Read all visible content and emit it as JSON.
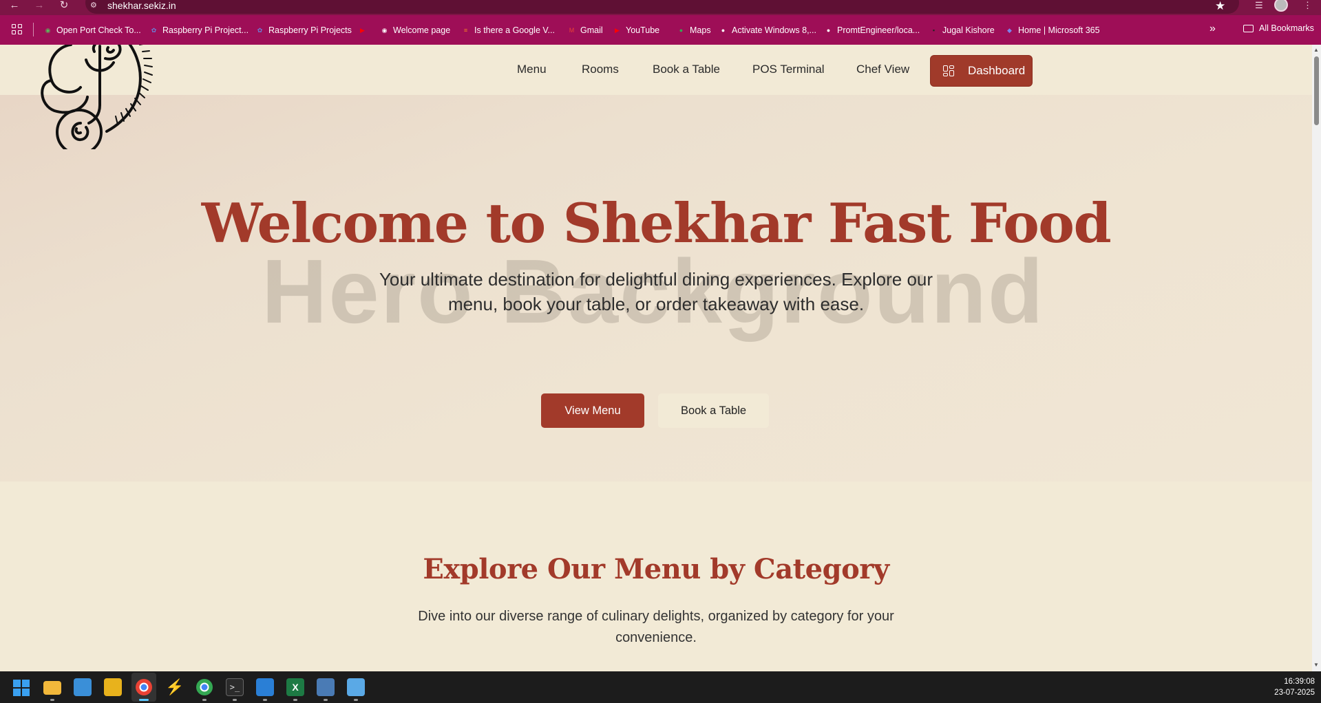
{
  "browser": {
    "url": "shekhar.sekiz.in",
    "back_icon": "arrow-left-icon",
    "forward_icon": "arrow-right-icon",
    "reload_icon": "reload-icon",
    "bookmarks": [
      {
        "label": "Open Port Check To...",
        "icon": "globe-icon",
        "color": "#5cb85c"
      },
      {
        "label": "Raspberry Pi Project...",
        "icon": "pi-icon",
        "color": "#6b7fd7"
      },
      {
        "label": "Raspberry Pi Projects",
        "icon": "pi-icon",
        "color": "#6b7fd7"
      },
      {
        "label": "",
        "icon": "youtube-icon",
        "color": "#ff0000"
      },
      {
        "label": "Welcome page",
        "icon": "globe-icon",
        "color": "#ffffff"
      },
      {
        "label": "Is there a Google V...",
        "icon": "stackoverflow-icon",
        "color": "#f48024"
      },
      {
        "label": "Gmail",
        "icon": "gmail-icon",
        "color": "#ea4335"
      },
      {
        "label": "YouTube",
        "icon": "youtube-icon",
        "color": "#ff0000"
      },
      {
        "label": "Maps",
        "icon": "maps-icon",
        "color": "#34a853"
      },
      {
        "label": "Activate Windows 8,...",
        "icon": "github-icon",
        "color": "#ffffff"
      },
      {
        "label": "PromtEngineer/loca...",
        "icon": "github-icon",
        "color": "#ffffff"
      },
      {
        "label": "Jugal Kishore",
        "icon": "terminal-icon",
        "color": "#222222"
      },
      {
        "label": "Home | Microsoft 365",
        "icon": "m365-icon",
        "color": "#7b83eb"
      }
    ],
    "all_bookmarks": "All Bookmarks"
  },
  "site": {
    "nav": [
      "Menu",
      "Rooms",
      "Book a Table",
      "POS Terminal",
      "Chef View"
    ],
    "dashboard_label": "Dashboard",
    "hero_watermark": "Hero Background",
    "hero_title": "Welcome to Shekhar Fast Food",
    "hero_subtitle": "Your ultimate destination for delightful dining experiences. Explore our menu, book your table, or order takeaway with ease.",
    "view_menu": "View Menu",
    "book_table": "Book a Table",
    "section_title": "Explore Our Menu by Category",
    "section_subtitle": "Dive into our diverse range of culinary delights, organized by category for your convenience."
  },
  "colors": {
    "accent": "#a23a2a",
    "page_bg": "#f2ead6",
    "chrome": "#7d1545",
    "bookmarks_bar": "#9e0e57"
  },
  "taskbar": {
    "apps": [
      "windows-start-icon",
      "file-explorer-icon",
      "buildings-app-icon",
      "archive-app-icon",
      "chrome-icon",
      "bolt-app-icon",
      "chrome-profile-icon",
      "terminal-icon",
      "vscode-icon",
      "excel-icon",
      "network-app-icon",
      "notepad-icon"
    ],
    "time": "16:39:08",
    "date": "23-07-2025"
  }
}
